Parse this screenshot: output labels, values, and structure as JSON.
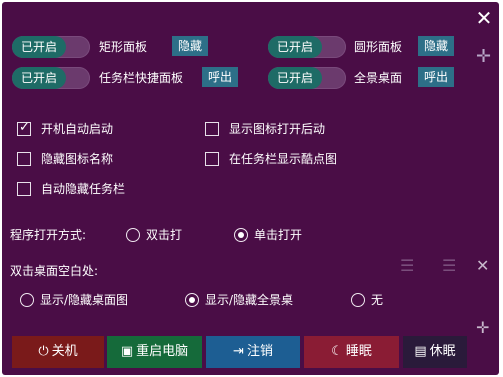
{
  "window": {
    "close_glyph": "✕"
  },
  "toggles": [
    {
      "state": "已开启",
      "label": "矩形面板",
      "button": "隐藏"
    },
    {
      "state": "已开启",
      "label": "圆形面板",
      "button": "隐藏"
    },
    {
      "state": "已开启",
      "label": "任务栏快捷面板",
      "button": "呼出"
    },
    {
      "state": "已开启",
      "label": "全景桌面",
      "button": "呼出"
    }
  ],
  "checkboxes": [
    {
      "label": "开机自动启动",
      "checked": true
    },
    {
      "label": "显示图标打开后动",
      "checked": false
    },
    {
      "label": "隐藏图标名称",
      "checked": false
    },
    {
      "label": "在任务栏显示酷点图",
      "checked": false
    },
    {
      "label": "自动隐藏任务栏",
      "checked": false
    }
  ],
  "open_mode": {
    "label": "程序打开方式:",
    "options": [
      {
        "label": "双击打",
        "selected": false
      },
      {
        "label": "单击打开",
        "selected": true
      }
    ]
  },
  "double_click": {
    "label": "双击桌面空白处:",
    "options": [
      {
        "label": "显示/隐藏桌面图",
        "selected": false
      },
      {
        "label": "显示/隐藏全景桌",
        "selected": true
      },
      {
        "label": "无",
        "selected": false
      }
    ]
  },
  "bottom_buttons": [
    {
      "label": "关机",
      "icon": "power-icon",
      "color": "#7a1a1a"
    },
    {
      "label": "重启电脑",
      "icon": "monitor-icon",
      "color": "#156a3a"
    },
    {
      "label": "注销",
      "icon": "logout-icon",
      "color": "#1d5e93"
    },
    {
      "label": "睡眠",
      "icon": "moon-icon",
      "color": "#8a1c34"
    },
    {
      "label": "休眠",
      "icon": "hibernate-icon",
      "color": "#2a1a3a"
    }
  ],
  "colors": {
    "background": "#4a0d46",
    "toggle_on": "#1e6b66",
    "toggle_btn": "#2d6f88"
  }
}
